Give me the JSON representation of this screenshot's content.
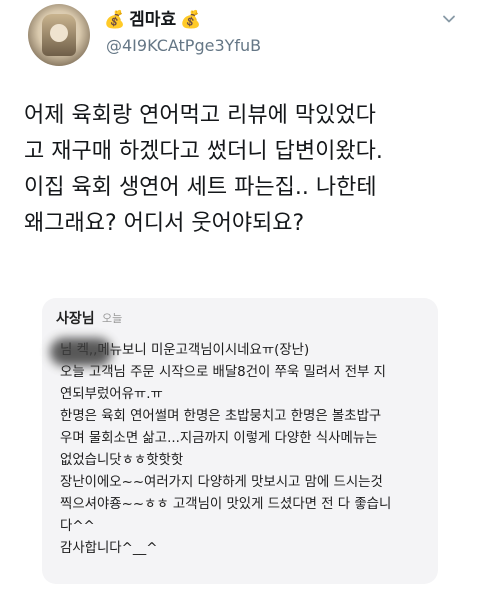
{
  "author": {
    "emoji_left": "💰",
    "display_name": "겜마효",
    "emoji_right": "💰",
    "handle": "@4I9KCAtPge3YfuB"
  },
  "tweet": {
    "text": "어제 육회랑 연어먹고 리뷰에 막있었다\n고 재구매 하겠다고 썼더니 답변이왔다.\n이집 육회 생연어 세트 파는집.. 나한테\n왜그래요? 어디서 웃어야되요?"
  },
  "reply_card": {
    "owner_label": "사장님",
    "when": "오늘",
    "body": "    님 켁,,메뉴보니 미운고객님이시네요ㅠ(장난)\n오늘 고객님 주문 시작으로 배달8건이 쭈욱 밀려서 전부 지\n연되부렀어유ㅠ.ㅠ\n한명은 육회 연어썰며 한명은 초밥뭉치고 한명은 볼초밥구\n우며 물회소면 삶고...지금까지 이렇게 다양한 식사메뉴는\n없었습니닷ㅎㅎ핫핫핫\n장난이에오~~여러가지 다양하게 맛보시고 맘에 드시는것\n찍으셔야죵~~ㅎㅎ 고객님이 맛있게 드셨다면 전 다 좋습니\n다^^\n감사합니다^__^"
  }
}
